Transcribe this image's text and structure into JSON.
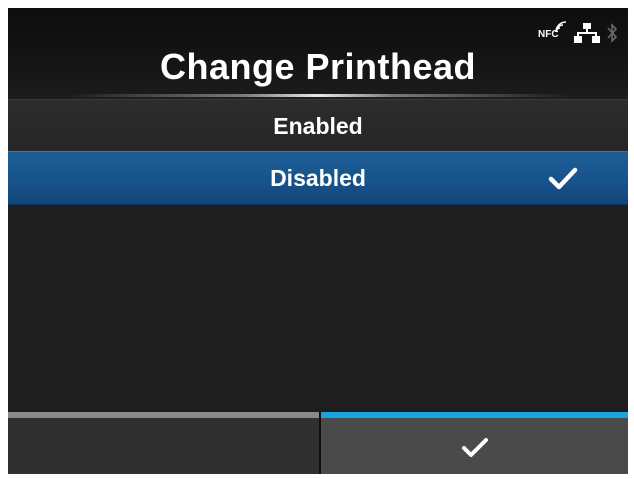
{
  "header": {
    "title": "Change Printhead",
    "status_icons": {
      "nfc_label": "NFC",
      "nfc": "nfc-icon",
      "network": "wired-network-icon",
      "bluetooth": "bluetooth-icon"
    }
  },
  "options": [
    {
      "label": "Enabled",
      "selected": false
    },
    {
      "label": "Disabled",
      "selected": true,
      "check_icon": "checkmark-icon"
    }
  ],
  "softkeys": {
    "left": {
      "label": "",
      "icon": ""
    },
    "right": {
      "label": "",
      "icon": "checkmark-icon"
    }
  },
  "colors": {
    "background": "#1e1e1e",
    "selected_row": "#17528a",
    "accent_bar": "#1aa3e0",
    "left_softkey_bar": "#8a8a8a",
    "text": "#ffffff"
  }
}
